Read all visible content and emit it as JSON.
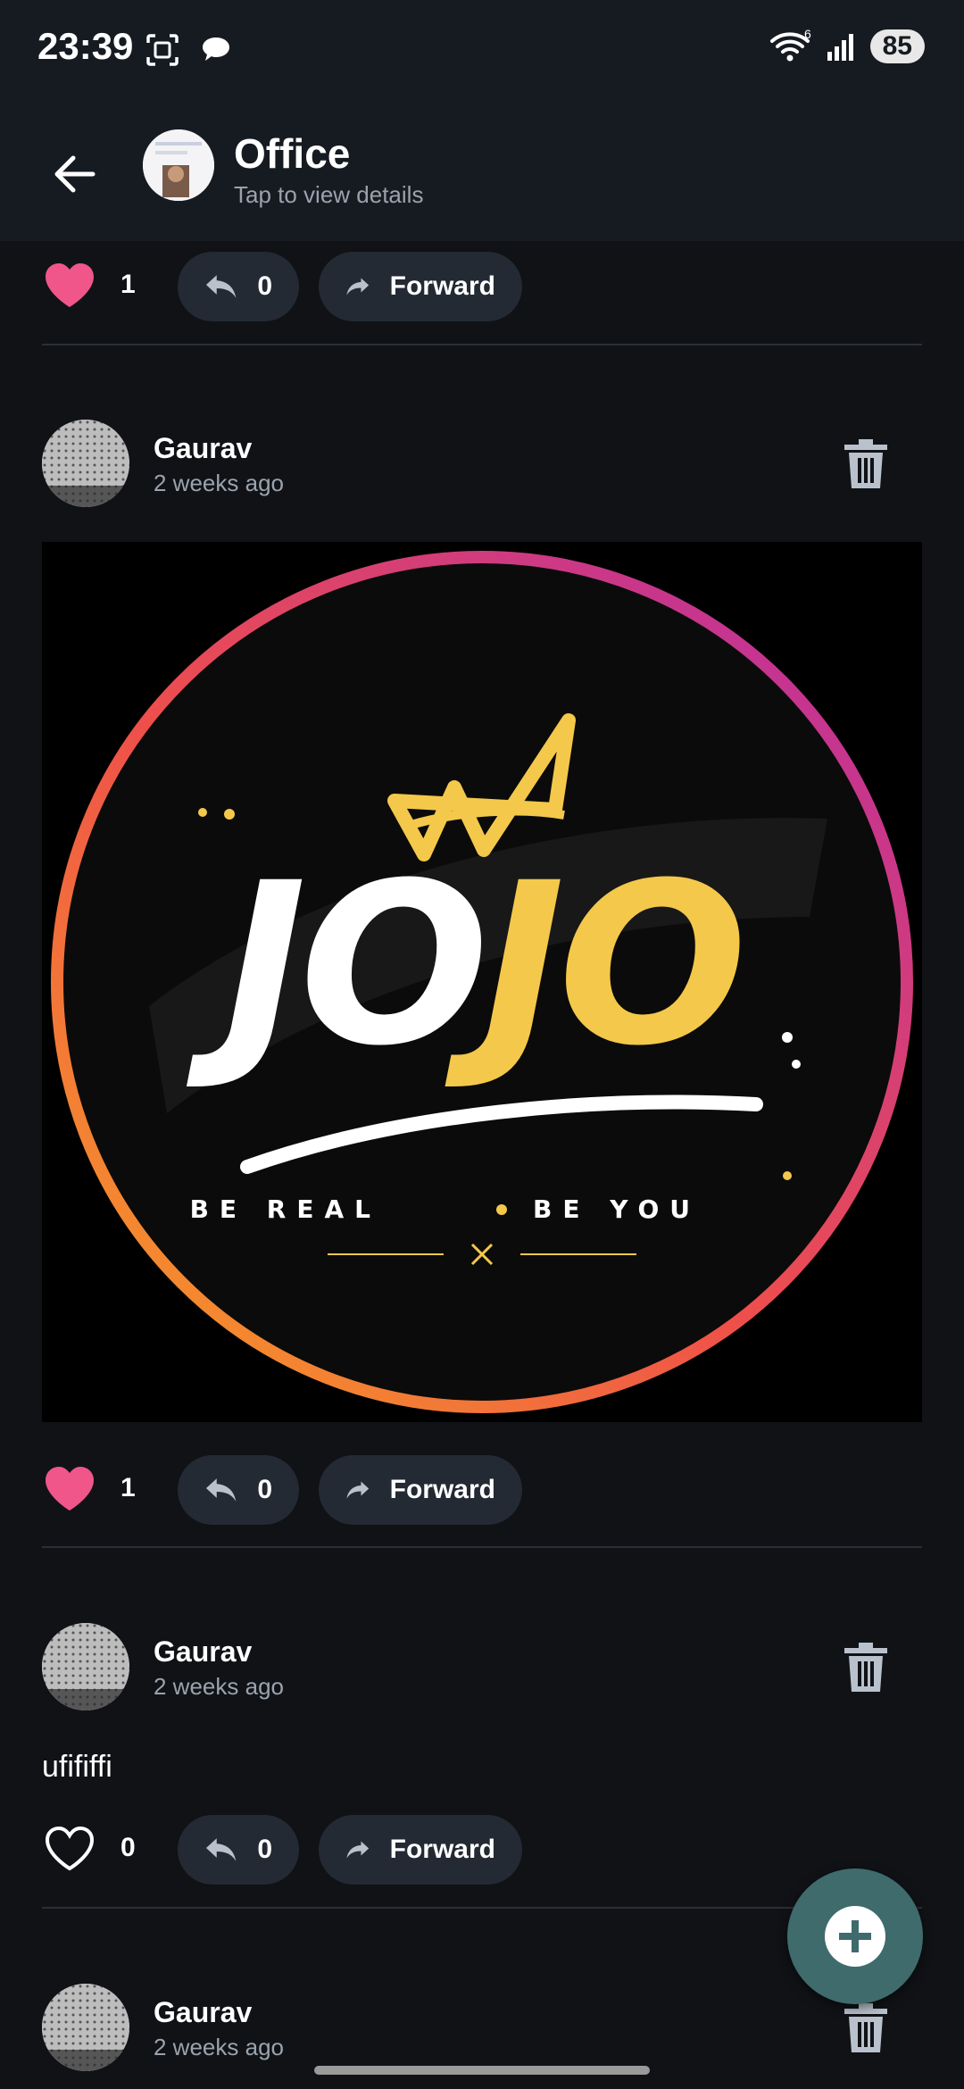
{
  "status_bar": {
    "time": "23:39",
    "battery": "85",
    "network_sup": "6"
  },
  "app_bar": {
    "title": "Office",
    "subtitle": "Tap to view details"
  },
  "forward_label": "Forward",
  "first_post_actions": {
    "likes": "1",
    "replies": "0"
  },
  "posts": [
    {
      "author": "Gaurav",
      "time": "2 weeks ago",
      "likes": "1",
      "replies": "0",
      "image": {
        "brand_text": "JOJO",
        "tagline_left": "BE REAL",
        "tagline_right": "BE YOU"
      }
    },
    {
      "author": "Gaurav",
      "time": "2 weeks ago",
      "text": "ufififfi",
      "likes": "0",
      "replies": "0"
    },
    {
      "author": "Gaurav",
      "time": "2 weeks ago"
    }
  ],
  "colors": {
    "background": "#101216",
    "header": "#161b22",
    "pill": "#232a34",
    "like": "#f0568a",
    "fab": "#3f6b6c"
  }
}
